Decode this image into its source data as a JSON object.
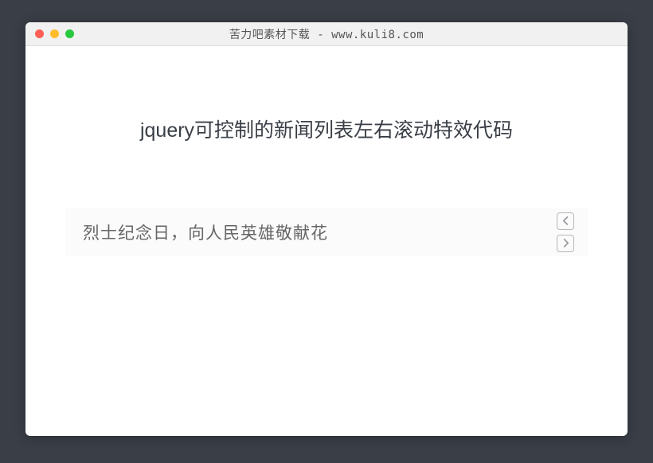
{
  "window": {
    "title": "苦力吧素材下载 - www.kuli8.com"
  },
  "page": {
    "heading": "jquery可控制的新闻列表左右滚动特效代码"
  },
  "ticker": {
    "current_text": "烈士纪念日，向人民英雄敬献花"
  }
}
